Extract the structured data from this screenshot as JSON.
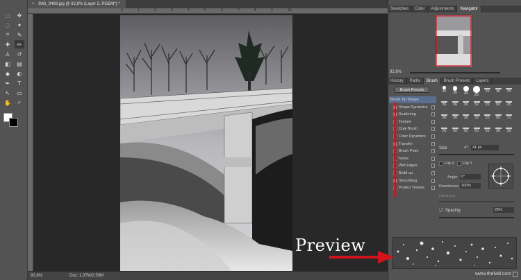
{
  "document": {
    "tab_title": "IMG_9489.jpg @ 92,8% (Layer 2, RGB/8*) *",
    "close": "×"
  },
  "ruler": {
    "marks": [
      "0",
      "1",
      "2",
      "3",
      "4",
      "5",
      "6",
      "7",
      "8",
      "9",
      "10"
    ]
  },
  "status": {
    "zoom": "92,8%",
    "doc": "Doc: 1,07M/2,50M"
  },
  "toolbar": {
    "icons": [
      "marquee-icon",
      "move-icon",
      "lasso-icon",
      "magic-wand-icon",
      "crop-icon",
      "eyedropper-icon",
      "healing-brush-icon",
      "brush-icon",
      "clone-stamp-icon",
      "history-brush-icon",
      "eraser-icon",
      "gradient-icon",
      "blur-icon",
      "dodge-icon",
      "pen-icon",
      "type-icon",
      "path-selection-icon",
      "rectangle-icon",
      "hand-icon",
      "zoom-icon"
    ],
    "glyphs": [
      "⬚",
      "✥",
      "◌",
      "✦",
      "⌗",
      "✎",
      "✚",
      "✏",
      "♙",
      "↺",
      "◧",
      "▤",
      "◆",
      "◐",
      "✒",
      "T",
      "↖",
      "▭",
      "✋",
      "⌕"
    ]
  },
  "colors": {
    "foreground": "#ffffff",
    "background": "#000000",
    "annotation": "#d4121c",
    "highlight": "#5a6e90"
  },
  "top_panel": {
    "tabs": [
      "Swatches",
      "Color",
      "Adjustments",
      "Navigator"
    ],
    "active": "Navigator",
    "zoom": "92,8%"
  },
  "brush_panel": {
    "tabs": [
      "History",
      "Paths",
      "Brush",
      "Brush Presets",
      "Layers"
    ],
    "active": "Brush",
    "presets_button": "Brush Presets",
    "items": [
      {
        "label": "Brush Tip Shape",
        "checked": false,
        "selected": true,
        "lock": false
      },
      {
        "label": "Shape Dynamics",
        "checked": true,
        "selected": false,
        "lock": true
      },
      {
        "label": "Scattering",
        "checked": true,
        "selected": false,
        "lock": true
      },
      {
        "label": "Texture",
        "checked": false,
        "selected": false,
        "lock": true
      },
      {
        "label": "Dual Brush",
        "checked": false,
        "selected": false,
        "lock": true
      },
      {
        "label": "Color Dynamics",
        "checked": false,
        "selected": false,
        "lock": true
      },
      {
        "label": "Transfer",
        "checked": true,
        "selected": false,
        "lock": true
      },
      {
        "label": "Brush Pose",
        "checked": false,
        "selected": false,
        "lock": true
      },
      {
        "label": "Noise",
        "checked": false,
        "selected": false,
        "lock": true
      },
      {
        "label": "Wet Edges",
        "checked": false,
        "selected": false,
        "lock": true
      },
      {
        "label": "Build-up",
        "checked": false,
        "selected": false,
        "lock": true
      },
      {
        "label": "Smoothing",
        "checked": true,
        "selected": false,
        "lock": true
      },
      {
        "label": "Protect Texture",
        "checked": false,
        "selected": false,
        "lock": true
      }
    ],
    "tip_sizes": [
      "30",
      "30",
      "30",
      "25",
      "25",
      "36",
      "25",
      "36",
      "36",
      "36",
      "32",
      "25",
      "50",
      "25",
      "36",
      "36",
      "36",
      "32",
      "25",
      "50",
      "71",
      "25",
      "50",
      "50",
      "50",
      "50",
      "36",
      "30"
    ],
    "size_label": "Size",
    "size_value": "41 px",
    "flip_x": "Flip X",
    "flip_y": "Flip Y",
    "angle_label": "Angle:",
    "angle_value": "0°",
    "roundness_label": "Roundness:",
    "roundness_value": "100%",
    "hardness_label": "Hardness",
    "spacing_label": "Spacing",
    "spacing_value": "25%"
  },
  "annotations": {
    "preview_text": "Preview"
  },
  "watermark": "www.thelvid.com"
}
